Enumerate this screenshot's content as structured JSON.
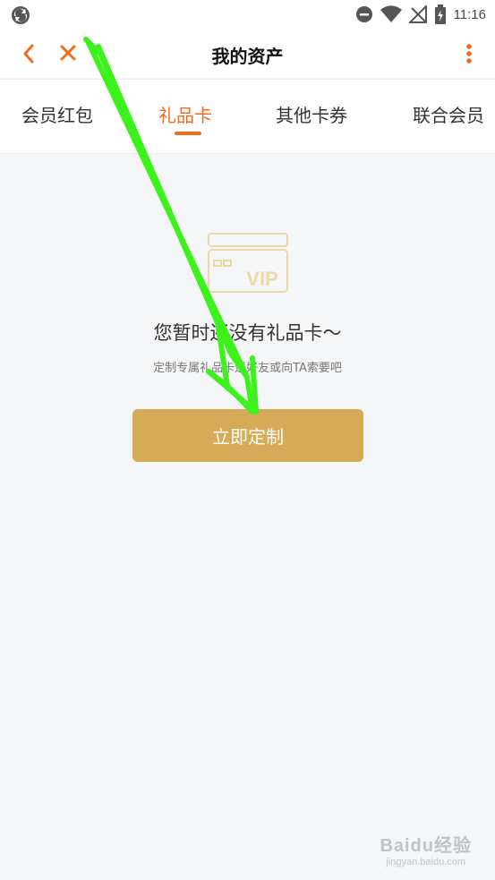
{
  "status_bar": {
    "time": "11:16"
  },
  "header": {
    "title": "我的资产"
  },
  "tabs": [
    {
      "label": "会员红包",
      "active": false
    },
    {
      "label": "礼品卡",
      "active": true
    },
    {
      "label": "其他卡券",
      "active": false
    },
    {
      "label": "联合会员",
      "active": false
    }
  ],
  "empty_state": {
    "card_text": "VIP",
    "title": "您暂时还没有礼品卡～",
    "subtitle": "定制专属礼品卡送好友或向TA索要吧",
    "button_label": "立即定制"
  },
  "watermark": {
    "brand": "Baidu经验",
    "url": "jingyan.baidu.com"
  },
  "colors": {
    "accent": "#f26b1d",
    "button_bg": "#d6ab58",
    "card_outline": "#ecd7a8",
    "annotation_arrow": "#3cf21a"
  }
}
